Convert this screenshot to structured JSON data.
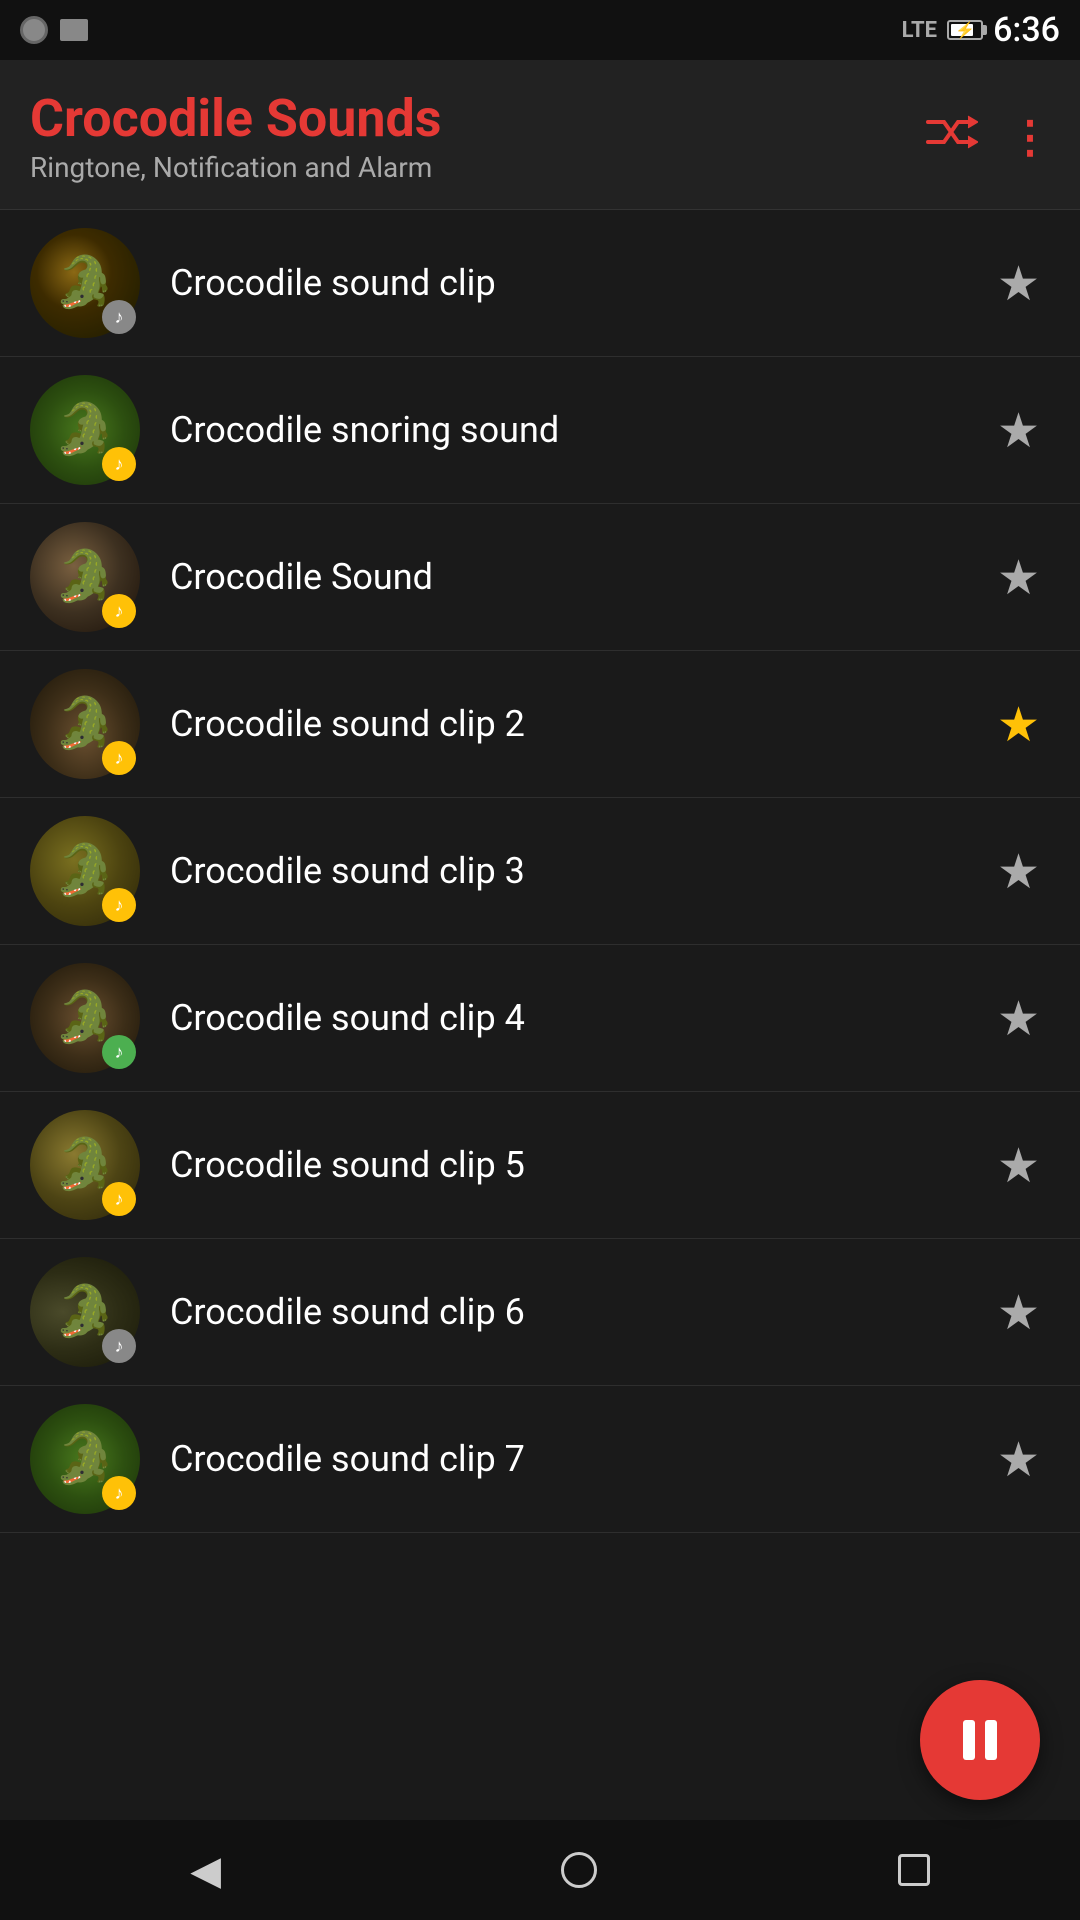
{
  "statusBar": {
    "time": "6:36",
    "network": "LTE"
  },
  "header": {
    "title": "Crocodile Sounds",
    "subtitle": "Ringtone, Notification and Alarm",
    "shuffleLabel": "shuffle",
    "moreLabel": "more options"
  },
  "sounds": [
    {
      "id": 1,
      "name": "Crocodile sound clip",
      "starred": false,
      "badgeColor": "gray",
      "thumbClass": "thumb-1"
    },
    {
      "id": 2,
      "name": "Crocodile snoring sound",
      "starred": false,
      "badgeColor": "yellow",
      "thumbClass": "thumb-2"
    },
    {
      "id": 3,
      "name": "Crocodile Sound",
      "starred": false,
      "badgeColor": "yellow",
      "thumbClass": "thumb-3"
    },
    {
      "id": 4,
      "name": "Crocodile sound clip 2",
      "starred": true,
      "badgeColor": "yellow",
      "thumbClass": "thumb-4"
    },
    {
      "id": 5,
      "name": "Crocodile sound clip 3",
      "starred": false,
      "badgeColor": "yellow",
      "thumbClass": "thumb-5"
    },
    {
      "id": 6,
      "name": "Crocodile sound clip 4",
      "starred": false,
      "badgeColor": "green",
      "thumbClass": "thumb-6"
    },
    {
      "id": 7,
      "name": "Crocodile sound clip 5",
      "starred": false,
      "badgeColor": "yellow",
      "thumbClass": "thumb-7"
    },
    {
      "id": 8,
      "name": "Crocodile sound clip 6",
      "starred": false,
      "badgeColor": "gray",
      "thumbClass": "thumb-8"
    },
    {
      "id": 9,
      "name": "Crocodile sound clip 7",
      "starred": false,
      "badgeColor": "yellow",
      "thumbClass": "thumb-9"
    }
  ],
  "fab": {
    "label": "pause"
  },
  "nav": {
    "back": "◀",
    "home": "",
    "recent": ""
  }
}
